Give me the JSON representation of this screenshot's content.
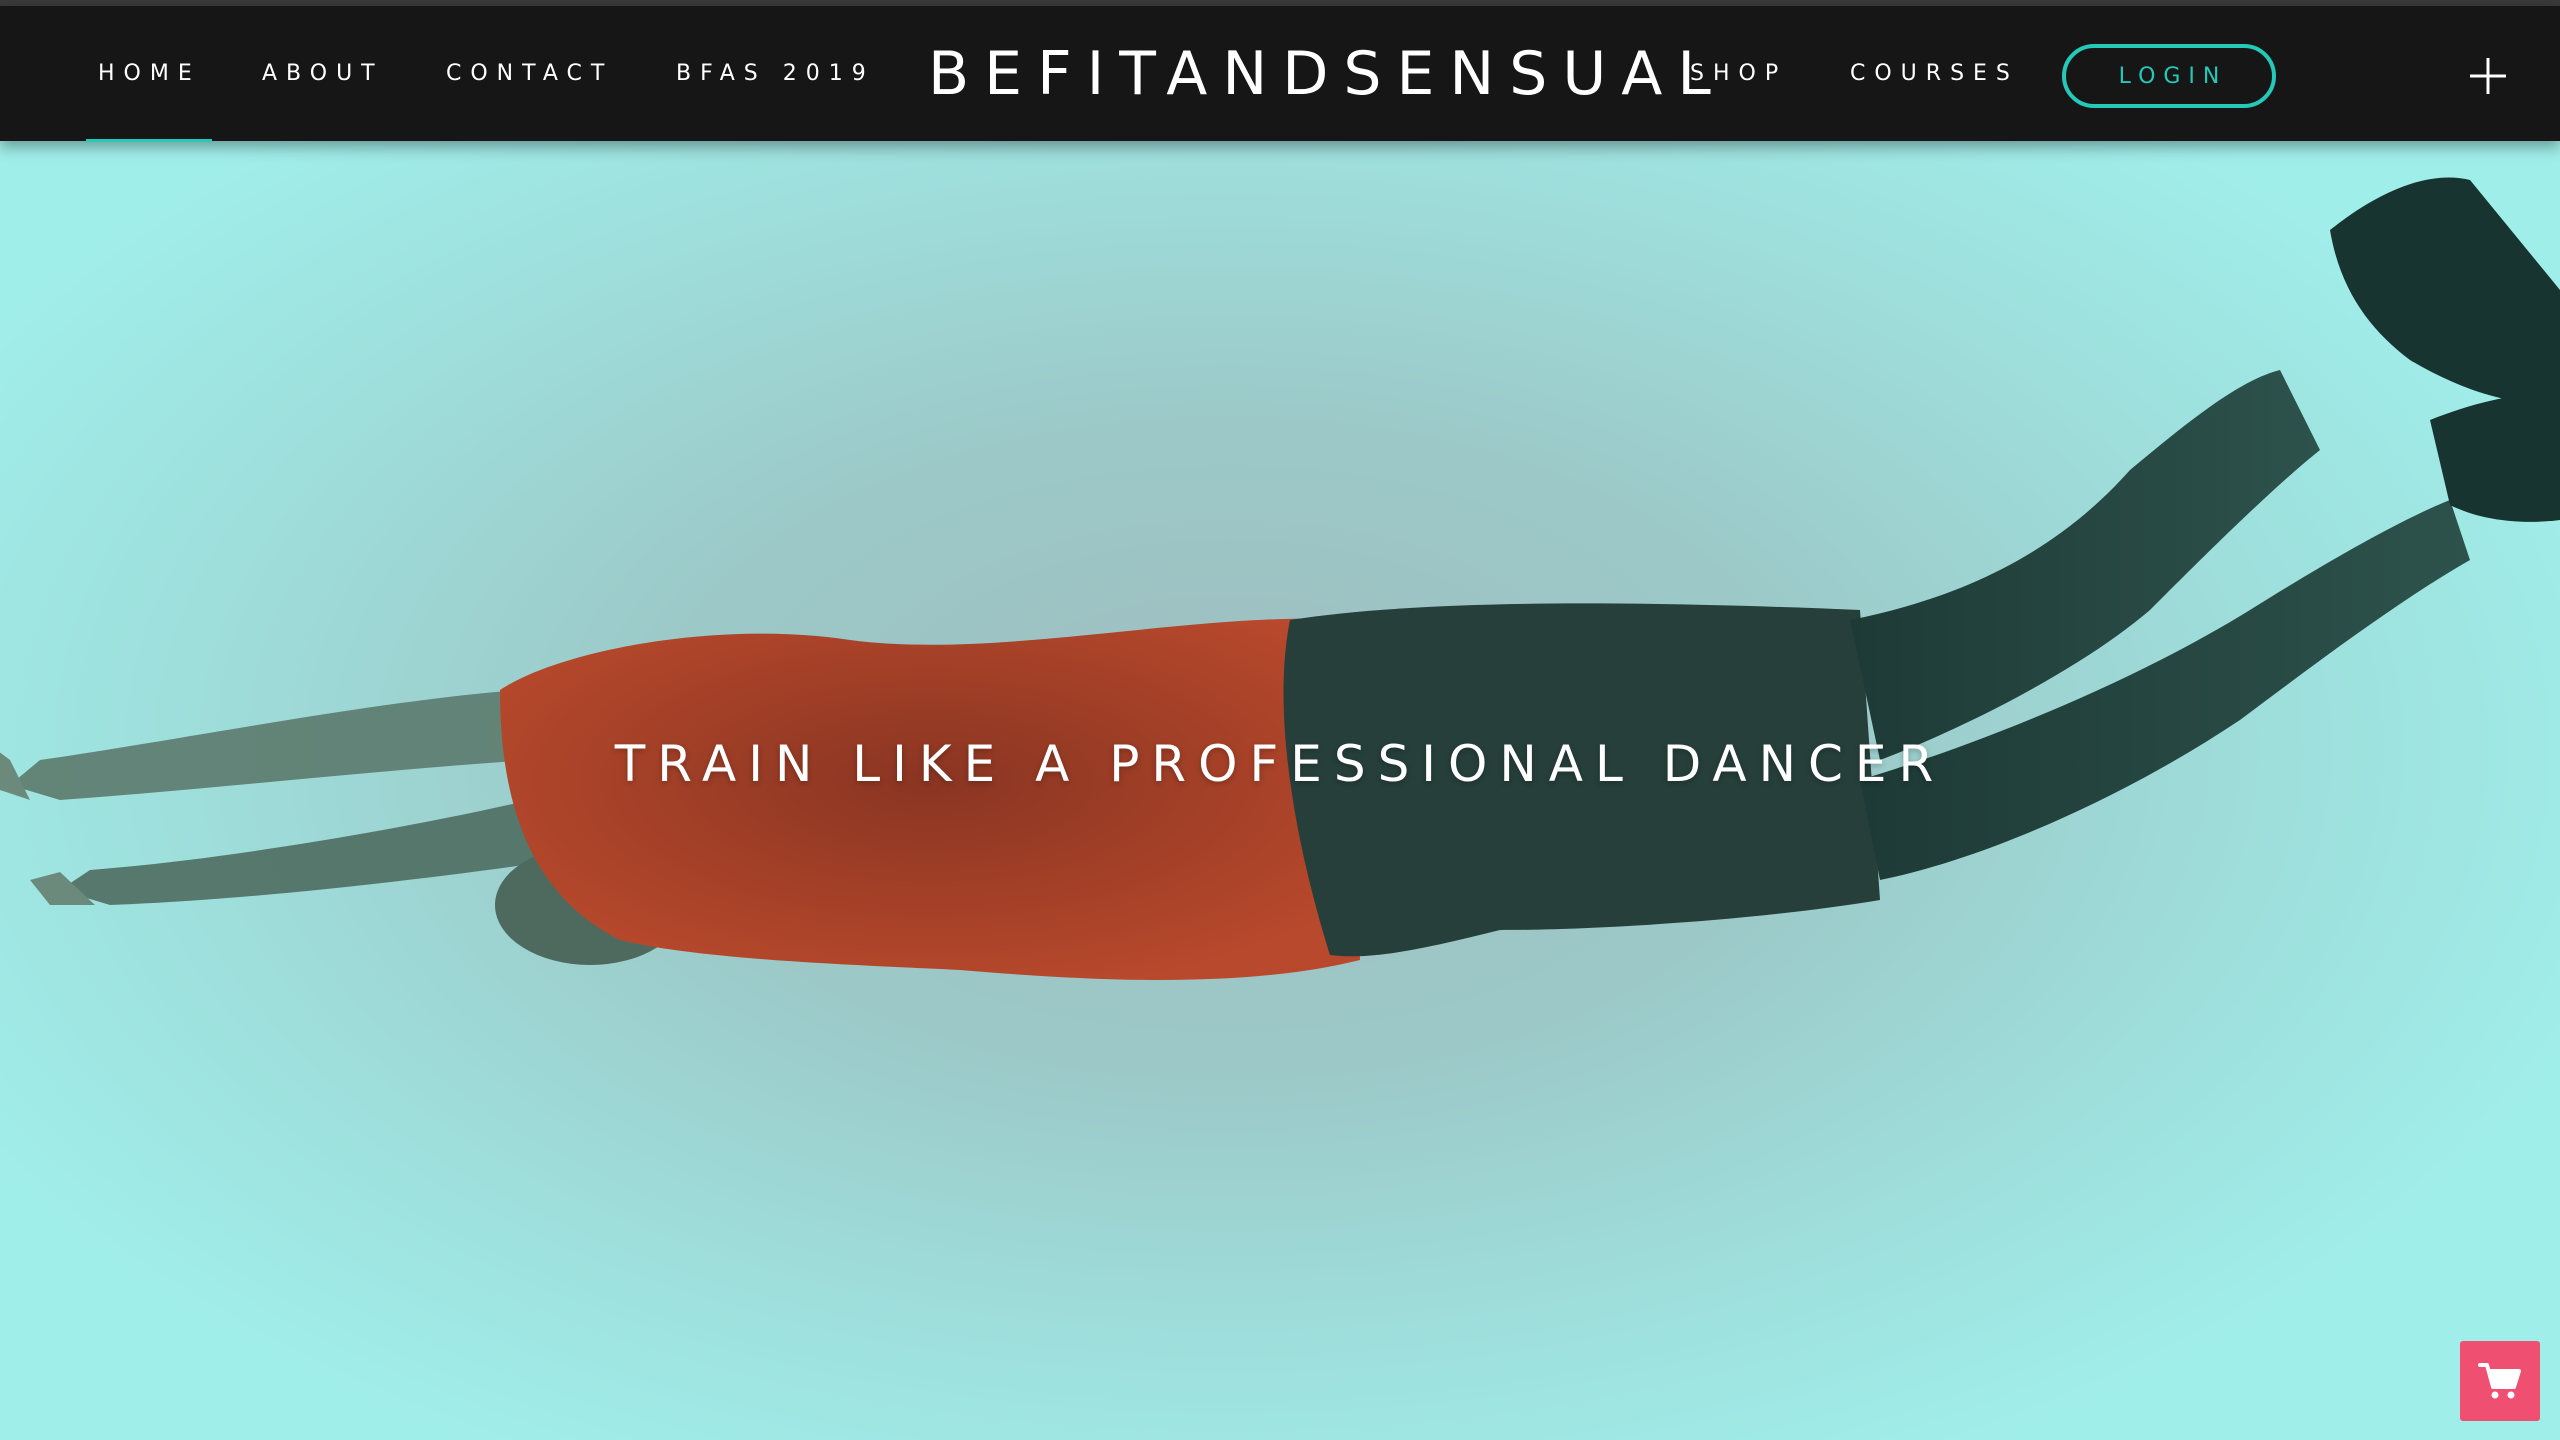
{
  "header": {
    "logo": "BEFITANDSENSUAL",
    "nav_left": [
      "HOME",
      "ABOUT",
      "CONTACT",
      "BFAS 2019"
    ],
    "nav_right": [
      "SHOP",
      "COURSES"
    ],
    "login_label": "LOGIN",
    "active_item": "HOME",
    "menu_icon": "plus-icon"
  },
  "hero": {
    "tagline": "TRAIN LIKE A PROFESSIONAL DANCER",
    "image": "dancer-flying-horizontal"
  },
  "cart": {
    "icon": "shopping-cart-icon"
  },
  "colors": {
    "accent": "#24c9b8",
    "header_bg": "#161616",
    "hero_bg": "#9eebe8",
    "cart_bg": "#ef4f70",
    "shirt": "#b0452a"
  }
}
